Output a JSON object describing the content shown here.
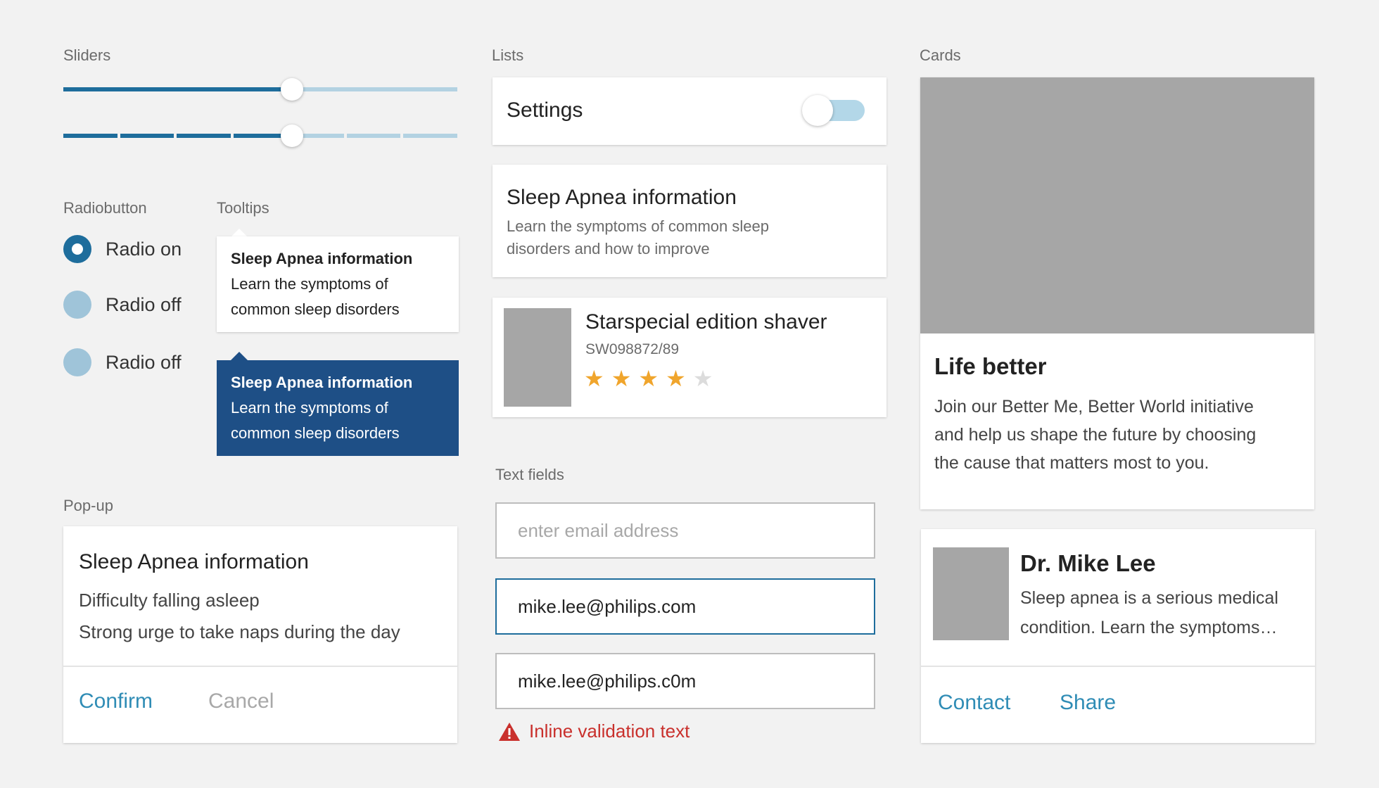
{
  "sections": {
    "sliders": "Sliders",
    "lists": "Lists",
    "cards": "Cards",
    "radiobutton": "Radiobutton",
    "tooltips": "Tooltips",
    "popup": "Pop-up",
    "textfields": "Text fields"
  },
  "sliders": {
    "continuous_value": 0.58,
    "stepped_value": 0.58,
    "stepped_steps": 7
  },
  "radios": [
    {
      "label": "Radio on",
      "checked": true
    },
    {
      "label": "Radio off",
      "checked": false
    },
    {
      "label": "Radio off",
      "checked": false
    }
  ],
  "tooltips": {
    "light": {
      "title": "Sleep Apnea information",
      "line1": "Learn the symptoms of",
      "line2": "common sleep disorders"
    },
    "dark": {
      "title": "Sleep Apnea information",
      "line1": "Learn the symptoms of",
      "line2": "common sleep disorders"
    }
  },
  "popup": {
    "title": "Sleep Apnea information",
    "line1": "Difficulty falling asleep",
    "line2": "Strong urge to take naps during the day",
    "confirm": "Confirm",
    "cancel": "Cancel"
  },
  "lists": {
    "settings": {
      "label": "Settings",
      "toggle_on": false
    },
    "info": {
      "title": "Sleep Apnea information",
      "line1": "Learn the symptoms of common sleep",
      "line2": "disorders and how to improve"
    },
    "product": {
      "title": "Starspecial edition shaver",
      "sku": "SW098872/89",
      "rating": 4,
      "max_rating": 5
    }
  },
  "textfields": {
    "empty": {
      "placeholder": "enter email address"
    },
    "focused": {
      "value": "mike.lee@philips.com"
    },
    "error": {
      "value": "mike.lee@philips.c0m"
    },
    "validation": "Inline validation text"
  },
  "cards": {
    "hero": {
      "title": "Life better",
      "line1": "Join our Better Me, Better World initiative",
      "line2": "and help us shape the future by choosing",
      "line3": "the cause that matters most to you."
    },
    "profile": {
      "name": "Dr. Mike Lee",
      "line1": "Sleep apnea is a serious medical",
      "line2": "condition. Learn the symptoms…",
      "contact": "Contact",
      "share": "Share"
    }
  },
  "colors": {
    "accent": "#1e6d9c",
    "tooltip_dark": "#1e4f86",
    "error": "#c9302c",
    "star": "#f0a52c",
    "link": "#2f8cb5"
  }
}
